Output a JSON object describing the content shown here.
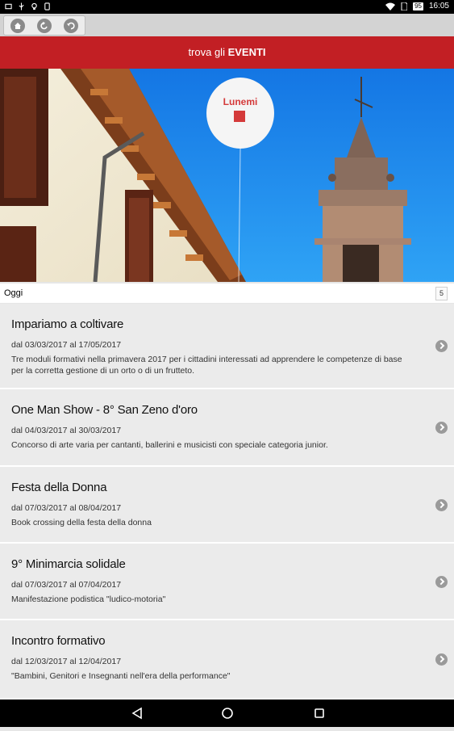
{
  "status_bar": {
    "time": "16:05",
    "battery": "95",
    "icons": [
      "notification-icon",
      "usb-icon",
      "bulb-icon",
      "phone-icon",
      "wifi-icon",
      "no-sim-icon",
      "battery-icon"
    ]
  },
  "toolbar": {
    "buttons": [
      "home-icon",
      "back-icon",
      "refresh-icon"
    ]
  },
  "header": {
    "prefix": "trova gli ",
    "strong": "EVENTI"
  },
  "oggi": {
    "label": "Oggi",
    "count": "5"
  },
  "events": [
    {
      "title": "Impariamo a coltivare",
      "date": "dal 03/03/2017 al 17/05/2017",
      "description": "Tre moduli formativi nella primavera 2017 per i cittadini interessati ad apprendere le competenze di base per la corretta gestione di un orto o di un frutteto."
    },
    {
      "title": "One Man Show - 8° San Zeno d'oro",
      "date": "dal 04/03/2017 al 30/03/2017",
      "description": "Concorso di arte varia per cantanti, ballerini e musicisti con speciale categoria junior."
    },
    {
      "title": "Festa della Donna",
      "date": "dal 07/03/2017 al 08/04/2017",
      "description": "Book crossing della festa della donna"
    },
    {
      "title": "9° Minimarcia solidale",
      "date": "dal 07/03/2017 al 07/04/2017",
      "description": "Manifestazione podistica \"ludico-motoria\""
    },
    {
      "title": "Incontro formativo",
      "date": "dal 12/03/2017 al 12/04/2017",
      "description": "\"Bambini, Genitori e Insegnanti nell'era della performance\""
    }
  ],
  "nav_bar": {
    "buttons": [
      "back-triangle-icon",
      "home-circle-icon",
      "recents-square-icon"
    ]
  },
  "colors": {
    "header_red": "#c21f24",
    "sky_blue": "#1e8ff0",
    "list_bg": "#ebebeb"
  }
}
